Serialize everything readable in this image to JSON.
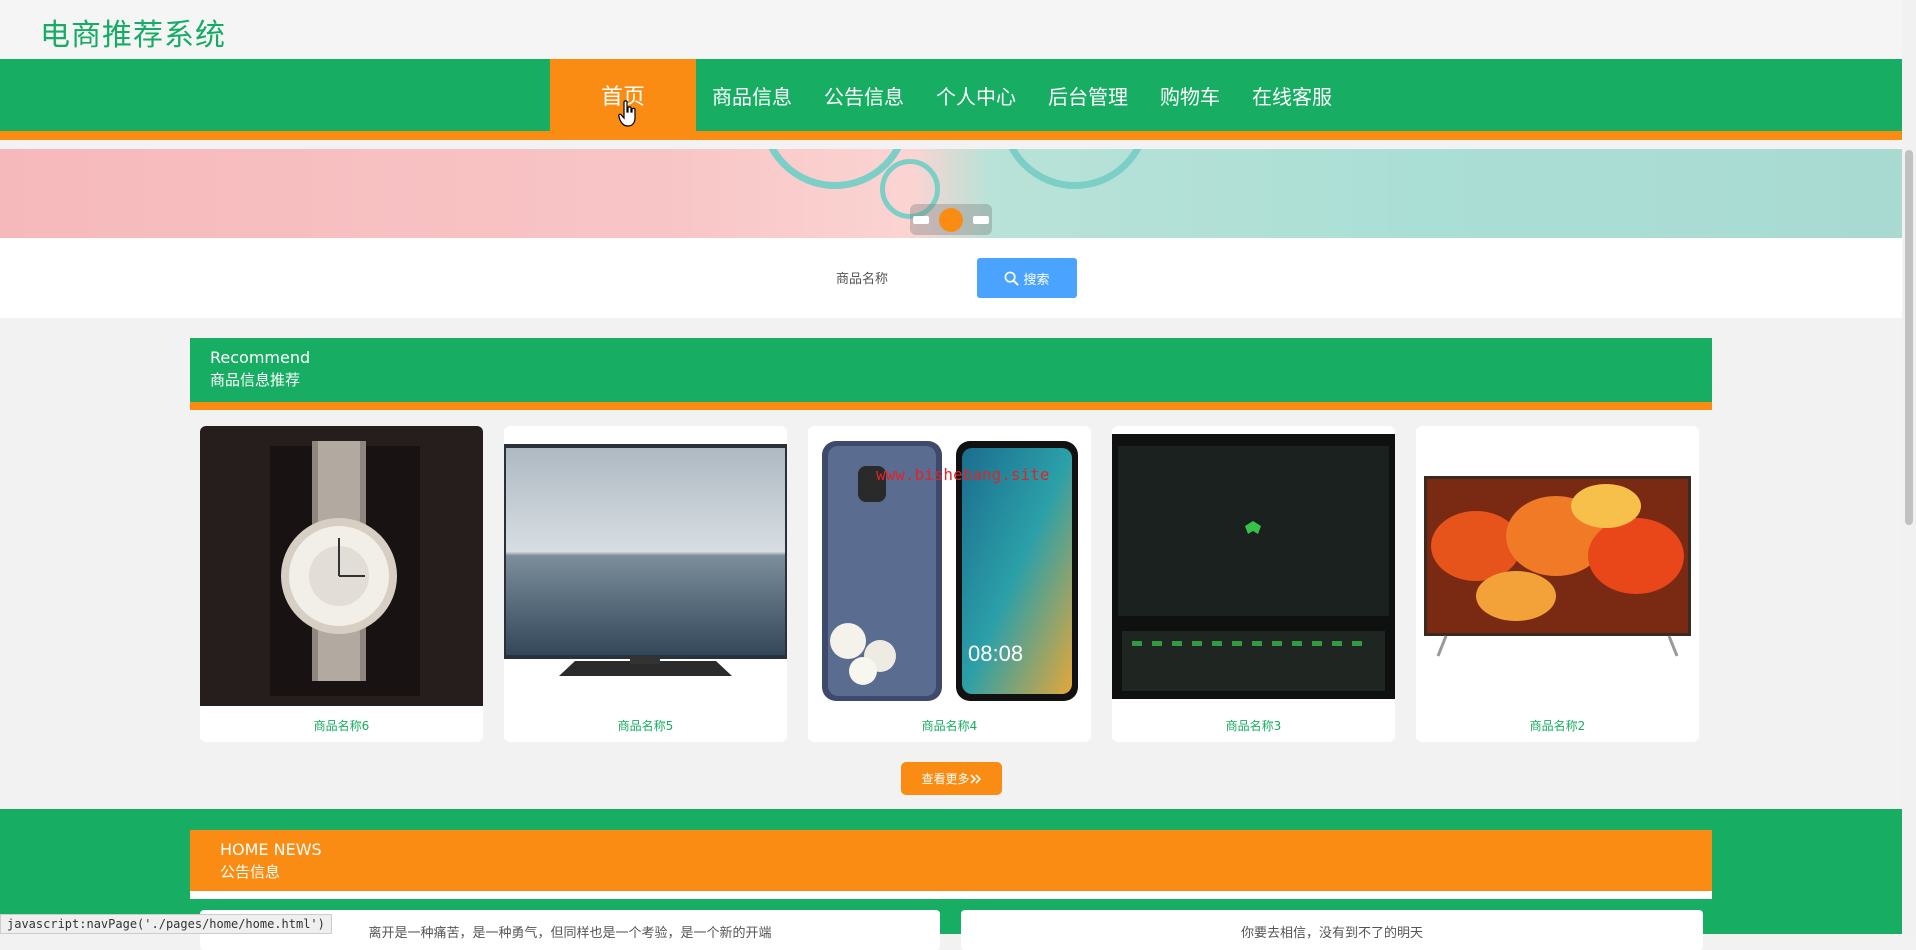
{
  "header": {
    "site_title": "电商推荐系统"
  },
  "nav": {
    "items": [
      {
        "label": "首页",
        "active": true
      },
      {
        "label": "商品信息"
      },
      {
        "label": "公告信息"
      },
      {
        "label": "个人中心"
      },
      {
        "label": "后台管理"
      },
      {
        "label": "购物车"
      },
      {
        "label": "在线客服"
      }
    ]
  },
  "search": {
    "label": "商品名称",
    "button_label": "搜索",
    "icon": "search-icon"
  },
  "recommend": {
    "title_en": "Recommend",
    "title_cn": "商品信息推荐",
    "products": [
      {
        "name": "商品名称6",
        "image": "watch"
      },
      {
        "name": "商品名称5",
        "image": "tv-sea"
      },
      {
        "name": "商品名称4",
        "image": "phones"
      },
      {
        "name": "商品名称3",
        "image": "laptop"
      },
      {
        "name": "商品名称2",
        "image": "tv-flowers"
      }
    ],
    "more_label": "查看更多"
  },
  "news": {
    "title_en": "HOME NEWS",
    "title_cn": "公告信息",
    "items": [
      {
        "text": "离开是一种痛苦，是一种勇气，但同样也是一个考验，是一个新的开端"
      },
      {
        "text": "你要去相信，没有到不了的明天"
      }
    ]
  },
  "watermark": "www.bishebang.site",
  "status_bar": "javascript:navPage('./pages/home/home.html')",
  "colors": {
    "primary": "#17ad62",
    "accent": "#fb8c13",
    "search": "#4aa3ff"
  }
}
